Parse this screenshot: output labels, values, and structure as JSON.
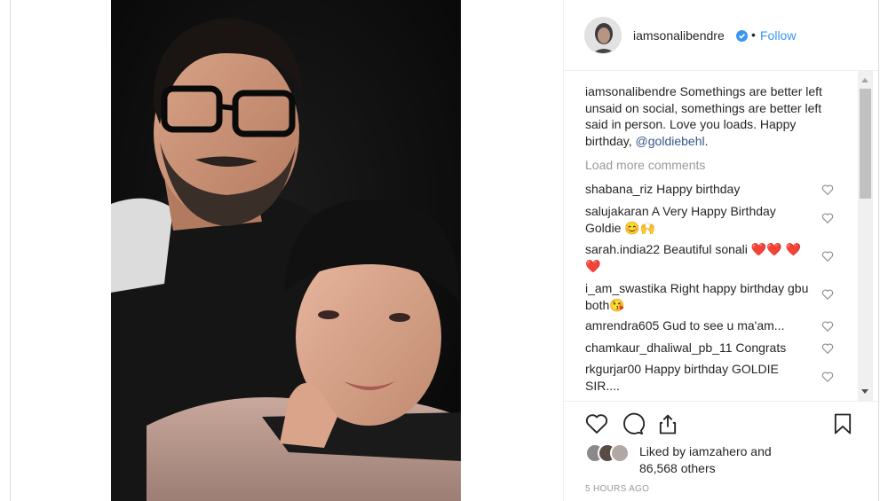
{
  "post": {
    "username": "iamsonalibendre",
    "separator": "•",
    "follow_label": "Follow",
    "caption_user": "iamsonalibendre",
    "caption_text": " Somethings are better left unsaid on social, somethings are better left said in person. Love you loads. Happy birthday, ",
    "caption_mention": "@goldiebehl",
    "caption_end": ".",
    "load_more": "Load more comments",
    "comments": [
      {
        "user": "shabana_riz",
        "text": " Happy birthday"
      },
      {
        "user": "salujakaran",
        "text": " A Very Happy Birthday Goldie 😊🙌"
      },
      {
        "user": "sarah.india22",
        "text": " Beautiful sonali ❤️❤️ ❤️❤️"
      },
      {
        "user": "i_am_swastika",
        "text": " Right happy birthday gbu both😘"
      },
      {
        "user": "amrendra605",
        "text": " Gud to see u ma'am..."
      },
      {
        "user": "chamkaur_dhaliwal_pb_11",
        "text": " Congrats"
      },
      {
        "user": "rkgurjar00",
        "text": " Happy birthday GOLDIE SIR...."
      }
    ],
    "likes_line1": "Liked by iamzahero and",
    "likes_line2": "86,568 others",
    "timestamp": "5 HOURS AGO"
  },
  "icons": {
    "verified": "verified-badge-icon",
    "like": "heart-icon",
    "comment": "comment-bubble-icon",
    "share": "share-icon",
    "save": "bookmark-icon"
  },
  "colors": {
    "link_blue": "#3897f0",
    "mention_blue": "#38568c",
    "muted_gray": "#999999",
    "heart_red": "#ed4956"
  }
}
